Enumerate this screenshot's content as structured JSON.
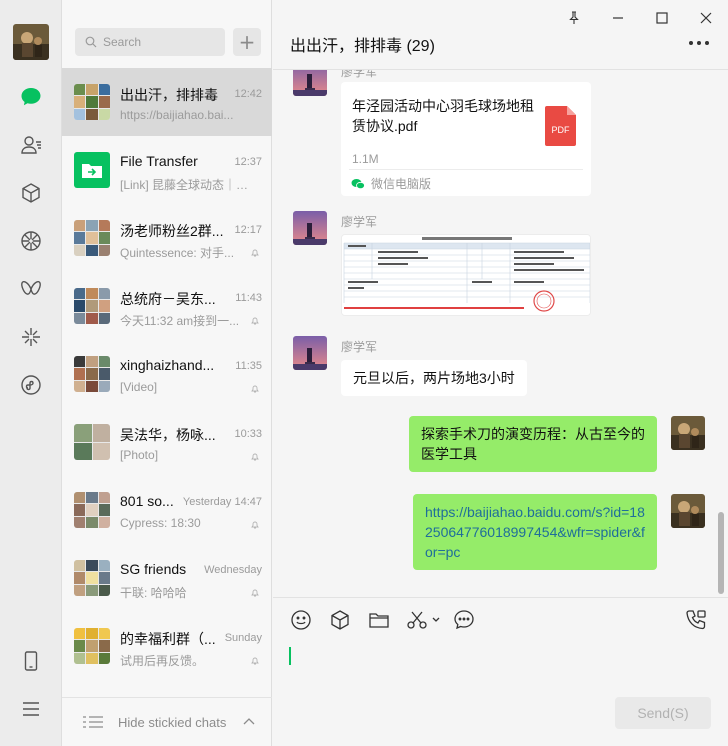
{
  "sidebar": {
    "icons": [
      "avatar",
      "chat-icon",
      "contacts-icon",
      "favorites-icon",
      "moments-icon",
      "channels-icon",
      "discover-icon",
      "mini-programs-icon",
      "phone-icon",
      "menu-icon"
    ]
  },
  "list": {
    "search_placeholder": "Search",
    "add_label": "+",
    "chats": [
      {
        "name": "出出汗，排排毒",
        "time": "12:42",
        "preview": "https://baijiahao.bai...",
        "muted": false,
        "active": true
      },
      {
        "name": "File Transfer",
        "time": "12:37",
        "preview": "[Link] 昆藤全球动态｜2...",
        "muted": false,
        "active": false
      },
      {
        "name": "汤老师粉丝2群...",
        "time": "12:17",
        "preview": "Quintessence: 对手...",
        "muted": true,
        "active": false
      },
      {
        "name": "总统府－吴东...",
        "time": "11:43",
        "preview": "今天11:32 am接到一...",
        "muted": true,
        "active": false
      },
      {
        "name": "xinghaizhand...",
        "time": "11:35",
        "preview": "[Video]",
        "muted": true,
        "active": false
      },
      {
        "name": "吴法华，杨咏...",
        "time": "10:33",
        "preview": "[Photo]",
        "muted": true,
        "active": false
      },
      {
        "name": "801 so...",
        "time": "Yesterday 14:47",
        "preview": "Cypress: 18:30",
        "muted": true,
        "active": false
      },
      {
        "name": "SG friends",
        "time": "Wednesday",
        "preview": "干联: 哈哈哈",
        "muted": true,
        "active": false
      },
      {
        "name": "的幸福利群（...",
        "time": "Sunday",
        "preview": "试用后再反馈。",
        "muted": true,
        "active": false
      }
    ],
    "hide_stickied": "Hide stickied chats"
  },
  "main": {
    "title": "出出汗，排排毒 (29)",
    "messages": {
      "m1_sender": "廖学军",
      "file_name": "年泾园活动中心羽毛球场地租赁协议.pdf",
      "file_size": "1.1M",
      "file_source": "微信电脑版",
      "pdf_label": "PDF",
      "m2_sender": "廖学军",
      "m3_sender": "廖学军",
      "m3_text": "元旦以后，两片场地3小时",
      "m4_text": "探索手术刀的演变历程：从古至今的医学工具",
      "m5_text": "https://baijiahao.baidu.com/s?id=1825064776018997454&wfr=spider&for=pc"
    },
    "send_label": "Send(S)"
  },
  "colors": {
    "accent": "#07c160",
    "bubble_self": "#95ec69",
    "link": "#1f6e9a"
  }
}
